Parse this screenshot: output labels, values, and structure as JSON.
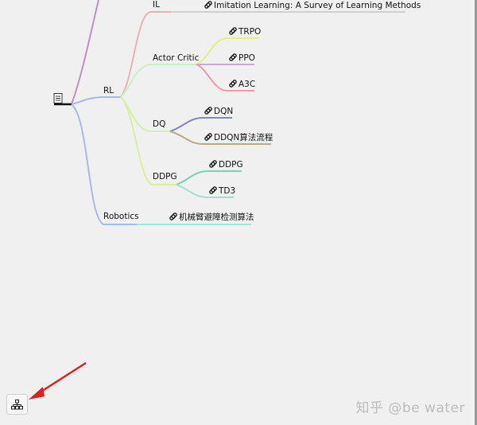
{
  "mindmap": {
    "branches": {
      "rl": "RL",
      "robotics": "Robotics"
    },
    "subbranches": {
      "il": "IL",
      "actor_critic": "Actor Critic",
      "dq": "DQ",
      "ddpg": "DDPG"
    },
    "leaves": {
      "imitation": "Imitation Learning: A Survey of Learning Methods",
      "trpo": "TRPO",
      "ppo": "PPO",
      "a3c": "A3C",
      "dqn": "DQN",
      "ddqn": "DDQN算法流程",
      "ddpg": "DDPG",
      "td3": "TD3",
      "robot_arm": "机械臂避障检测算法"
    },
    "colors": {
      "root_branch_top": "#c58ec2",
      "rl_branch": "#a7b6ec",
      "robotics_branch": "#a9b8ee",
      "il": "#eab2b5",
      "actor_critic": "#c8f0c8",
      "dq": "#d2efb4",
      "ddpg": "#d8ef9e",
      "trpo": "#e6ee82",
      "ppo": "#c9a8d8",
      "a3c": "#f29aa6",
      "dqn": "#7f86c4",
      "ddqn": "#b8a98a",
      "ddpg_leaf": "#7fcfb8",
      "td3": "#9fe0d4",
      "robot_arm": "#9fe6d8"
    }
  },
  "toolbar": {
    "view_icon": "hierarchy-icon"
  },
  "watermark": {
    "text": "知乎 @be water"
  }
}
